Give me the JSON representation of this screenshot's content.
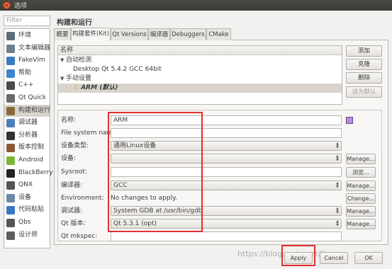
{
  "window": {
    "title": "选项"
  },
  "filter": {
    "placeholder": "Filter"
  },
  "page_title": "构建和运行",
  "nav": [
    {
      "label": "环境",
      "icon": "environment-icon",
      "color": "#5a6b7c"
    },
    {
      "label": "文本编辑器",
      "icon": "text-editor-icon",
      "color": "#6d7f8f"
    },
    {
      "label": "FakeVim",
      "icon": "fakevim-icon",
      "color": "#3d7bbf"
    },
    {
      "label": "帮助",
      "icon": "help-icon",
      "color": "#3b86c9"
    },
    {
      "label": "C++",
      "icon": "cpp-icon",
      "color": "#4b4b4b"
    },
    {
      "label": "Qt Quick",
      "icon": "qt-quick-icon",
      "color": "#6a6a6a"
    },
    {
      "label": "构建和运行",
      "icon": "build-run-icon",
      "color": "#8a6a3a"
    },
    {
      "label": "调试器",
      "icon": "debugger-icon",
      "color": "#4d7fb7"
    },
    {
      "label": "分析器",
      "icon": "analyzer-icon",
      "color": "#333333"
    },
    {
      "label": "版本控制",
      "icon": "version-control-icon",
      "color": "#8c5a35"
    },
    {
      "label": "Android",
      "icon": "android-icon",
      "color": "#7ab53a"
    },
    {
      "label": "BlackBerry",
      "icon": "blackberry-icon",
      "color": "#222222"
    },
    {
      "label": "QNX",
      "icon": "qnx-icon",
      "color": "#555555"
    },
    {
      "label": "设备",
      "icon": "devices-icon",
      "color": "#6b8aa8"
    },
    {
      "label": "代码粘贴",
      "icon": "code-paste-icon",
      "color": "#3c78c0"
    },
    {
      "label": "Qbs",
      "icon": "qbs-icon",
      "color": "#555555"
    },
    {
      "label": "设计师",
      "icon": "designer-icon",
      "color": "#5d5d5d"
    }
  ],
  "tabs": [
    "概要",
    "构建套件(Kit)",
    "Qt Versions",
    "编译器",
    "Debuggers",
    "CMake"
  ],
  "kit_list": {
    "header": "名称",
    "rows": [
      {
        "label": "自动检测"
      },
      {
        "label": "Desktop Qt 5.4.2 GCC 64bit"
      },
      {
        "label": "手动设置"
      },
      {
        "label": "ARM (默认)"
      }
    ]
  },
  "side_buttons": {
    "add": "添加",
    "clone": "克隆",
    "remove": "删除",
    "make_default": "设为默认"
  },
  "form": {
    "name_label": "名称:",
    "name_value": "ARM",
    "fs_label": "File system name:",
    "fs_value": "",
    "device_type_label": "设备类型:",
    "device_type_value": "通用Linux设备",
    "device_label": "设备:",
    "device_value": "",
    "sysroot_label": "Sysroot:",
    "sysroot_value": "",
    "compiler_label": "编译器:",
    "compiler_value": "GCC",
    "env_label": "Environment:",
    "env_value": "No changes to apply.",
    "debugger_label": "调试器:",
    "debugger_value": "System GDB at /usr/bin/gdb",
    "qt_version_label": "Qt 版本:",
    "qt_version_value": "Qt 5.3.1 (opt)",
    "mkspec_label": "Qt mkspec:",
    "mkspec_value": ""
  },
  "right_buttons": {
    "manage": "Manage...",
    "browse": "浏览...",
    "change": "Change..."
  },
  "bottom_buttons": {
    "apply": "Apply",
    "cancel": "Cancel",
    "ok": "OK"
  },
  "watermark": "https://blog.csdn.net/Yazaup"
}
